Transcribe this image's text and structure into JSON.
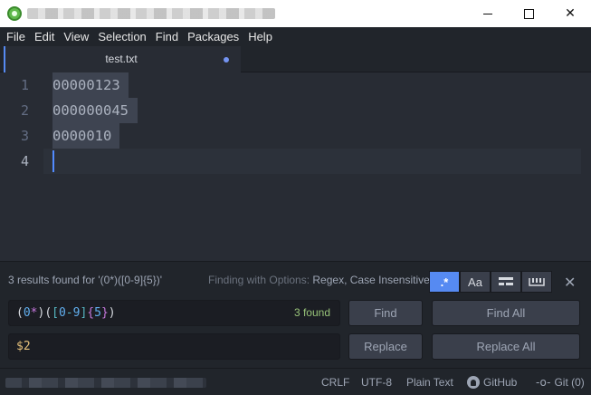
{
  "window": {
    "minimize_glyph": "",
    "close_glyph": "✕"
  },
  "menu": [
    "File",
    "Edit",
    "View",
    "Selection",
    "Find",
    "Packages",
    "Help"
  ],
  "tab": {
    "title": "test.txt",
    "modified": true
  },
  "editor": {
    "lines": [
      {
        "number": "1",
        "text": "00000123"
      },
      {
        "number": "2",
        "text": "000000045"
      },
      {
        "number": "3",
        "text": "0000010"
      },
      {
        "number": "4",
        "text": ""
      }
    ]
  },
  "find": {
    "summary": "3 results found for '(0*)([0-9]{5})'",
    "options_label": "Finding with Options: ",
    "options_value": "Regex, Case Insensitive",
    "regex_label": ".*",
    "case_label": "Aa",
    "close_glyph": "✕",
    "query": "(0*)([0-9]{5})",
    "count": "3 found",
    "replace_value": "$2",
    "find_label": "Find",
    "find_all_label": "Find All",
    "replace_label": "Replace",
    "replace_all_label": "Replace All",
    "colors": {
      "regex_active": "#568af2",
      "count": "#98c379"
    }
  },
  "status": {
    "line_ending": "CRLF",
    "encoding": "UTF-8",
    "grammar": "Plain Text",
    "github": "GitHub",
    "git": "Git (0)"
  }
}
